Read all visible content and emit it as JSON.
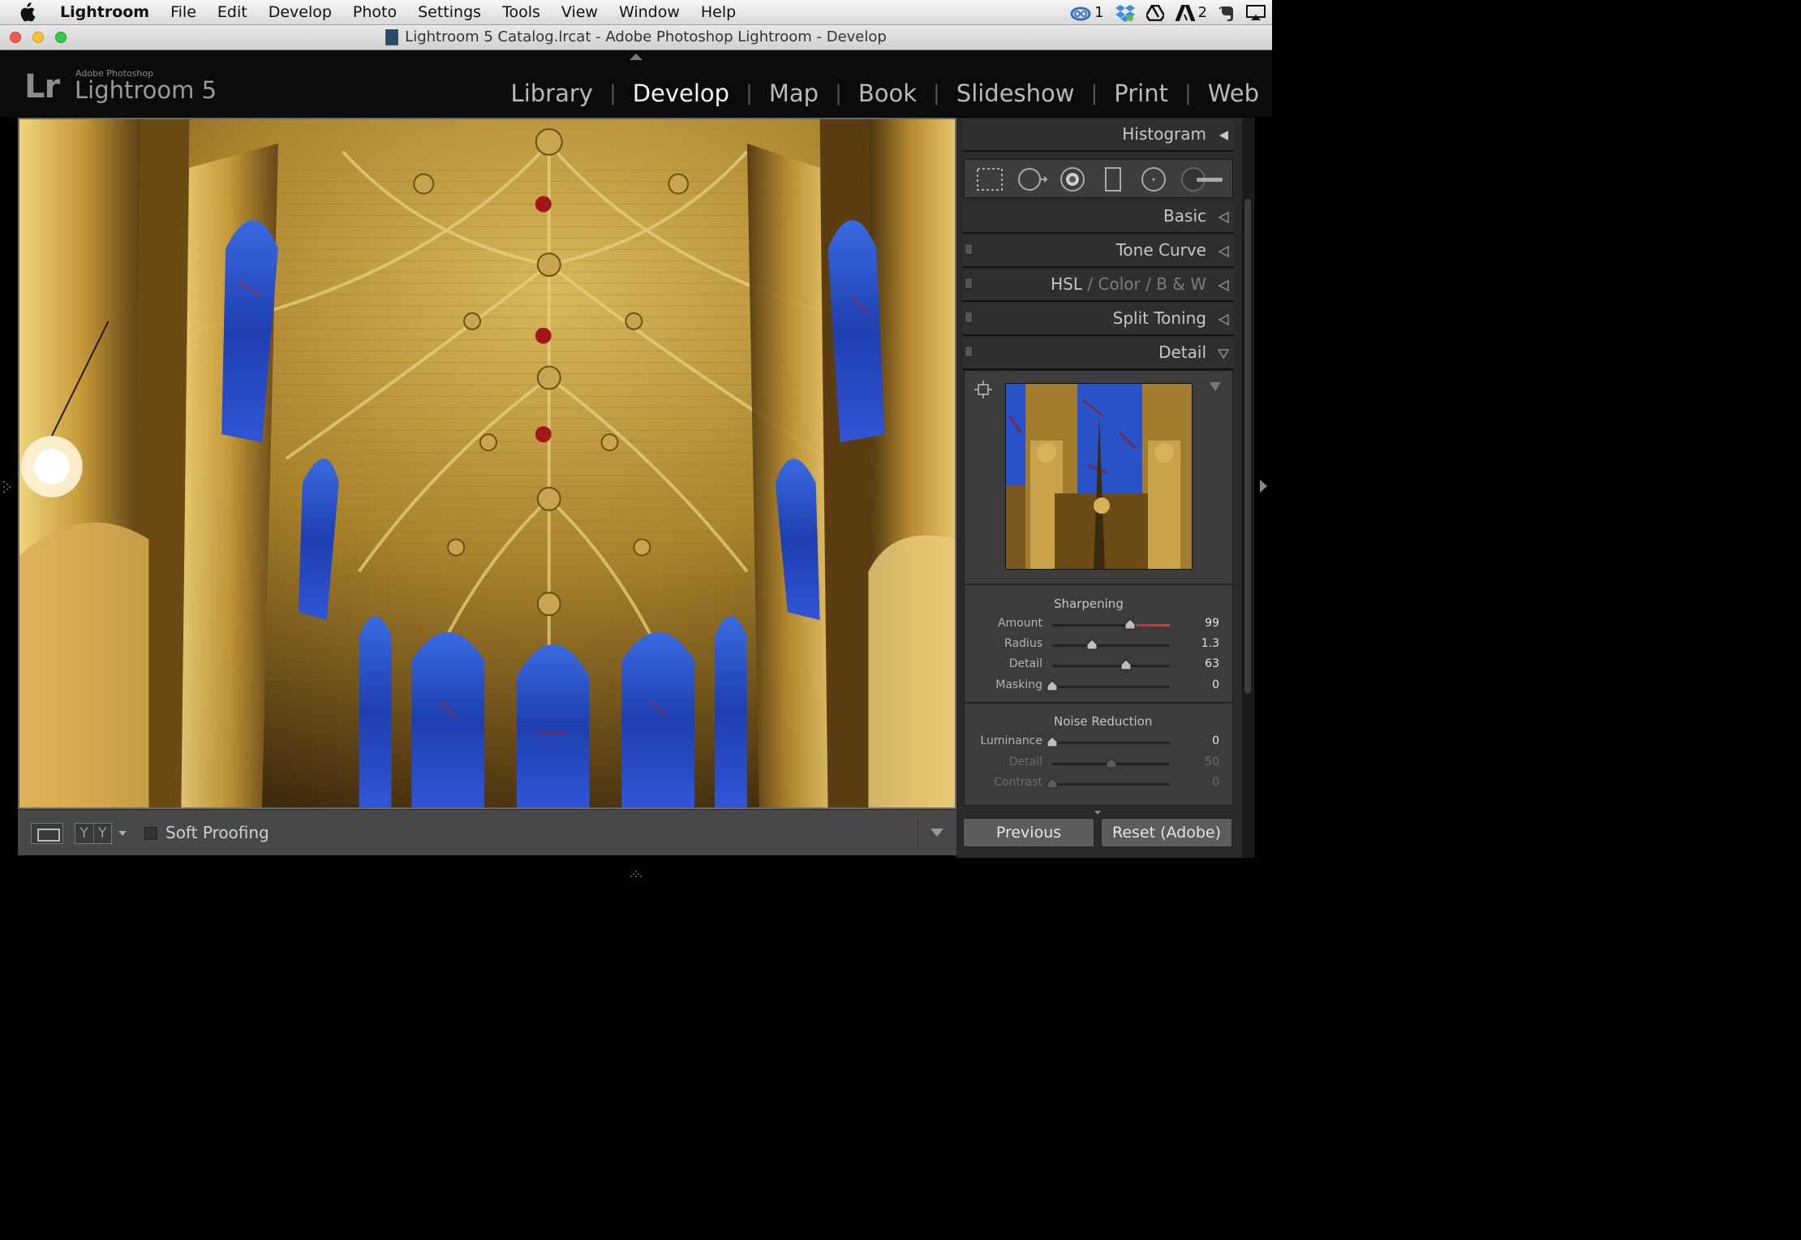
{
  "menubar": {
    "app": "Lightroom",
    "items": [
      "File",
      "Edit",
      "Develop",
      "Photo",
      "Settings",
      "Tools",
      "View",
      "Window",
      "Help"
    ],
    "tray": [
      {
        "icon": "creative-cloud-icon",
        "label": "1"
      },
      {
        "icon": "dropbox-icon",
        "label": ""
      },
      {
        "icon": "google-drive-icon",
        "label": ""
      },
      {
        "icon": "adobe-icon",
        "label": "2"
      },
      {
        "icon": "evernote-icon",
        "label": ""
      },
      {
        "icon": "airplay-icon",
        "label": ""
      }
    ]
  },
  "window": {
    "title": "Lightroom 5 Catalog.lrcat - Adobe Photoshop Lightroom - Develop"
  },
  "identity": {
    "logo": "Lr",
    "brand": "Adobe Photoshop",
    "product": "Lightroom 5"
  },
  "modules": [
    {
      "label": "Library",
      "active": false
    },
    {
      "label": "Develop",
      "active": true
    },
    {
      "label": "Map",
      "active": false
    },
    {
      "label": "Book",
      "active": false
    },
    {
      "label": "Slideshow",
      "active": false
    },
    {
      "label": "Print",
      "active": false
    },
    {
      "label": "Web",
      "active": false
    }
  ],
  "toolbar": {
    "compare_glyph": "Y",
    "soft_proofing": "Soft Proofing"
  },
  "panels": {
    "histogram": "Histogram",
    "basic": "Basic",
    "tone_curve": "Tone Curve",
    "hsl": "HSL",
    "hsl_sep": "/",
    "color": "Color",
    "bw": "B & W",
    "split_toning": "Split Toning",
    "detail": "Detail"
  },
  "sharpening": {
    "title": "Sharpening",
    "sliders": [
      {
        "label": "Amount",
        "value": "99",
        "pos": 0.66,
        "dim": false
      },
      {
        "label": "Radius",
        "value": "1.3",
        "pos": 0.34,
        "dim": false
      },
      {
        "label": "Detail",
        "value": "63",
        "pos": 0.63,
        "dim": false
      },
      {
        "label": "Masking",
        "value": "0",
        "pos": 0.0,
        "dim": false
      }
    ]
  },
  "noise_reduction": {
    "title": "Noise Reduction",
    "sliders": [
      {
        "label": "Luminance",
        "value": "0",
        "pos": 0.0,
        "dim": false
      },
      {
        "label": "Detail",
        "value": "50",
        "pos": 0.5,
        "dim": true
      },
      {
        "label": "Contrast",
        "value": "0",
        "pos": 0.0,
        "dim": true
      }
    ]
  },
  "buttons": {
    "previous": "Previous",
    "reset": "Reset (Adobe)"
  },
  "colors": {
    "accent_red": "#c44444",
    "panel_bg": "#2a2a2a",
    "photo_gold": "#b8912f",
    "glass_blue": "#2a53c8"
  }
}
